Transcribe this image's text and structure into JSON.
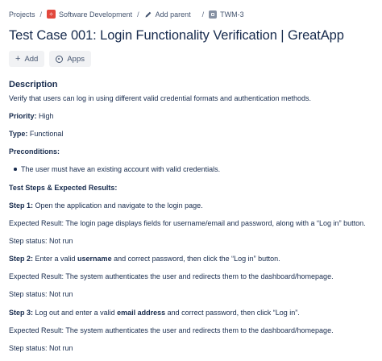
{
  "breadcrumb": {
    "projects": "Projects",
    "project": "Software Development",
    "add_parent": "Add parent",
    "issue_key": "TWM-3"
  },
  "title": "Test Case 001: Login Functionality Verification | GreatApp",
  "actions": {
    "add": "Add",
    "apps": "Apps"
  },
  "description": {
    "heading": "Description",
    "text": "Verify that users can log in using different valid credential formats and authentication methods.",
    "priority_label": "Priority:",
    "priority_value": " High",
    "type_label": "Type:",
    "type_value": " Functional",
    "preconditions_label": "Preconditions:",
    "preconditions": [
      "The user must have an existing account with valid credentials."
    ],
    "steps_label": "Test Steps & Expected Results:",
    "steps": [
      {
        "label": "Step 1:",
        "pre": " Open the application and navigate to the login page.",
        "bold": "",
        "post": "",
        "expected": "Expected Result: The login page displays fields for username/email and password, along with a “Log in” button.",
        "status": "Step status: Not run"
      },
      {
        "label": "Step 2:",
        "pre": " Enter a valid ",
        "bold": "username",
        "post": " and correct password, then click the “Log in” button.",
        "expected": "Expected Result: The system authenticates the user and redirects them to the dashboard/homepage.",
        "status": "Step status: Not run"
      },
      {
        "label": "Step 3:",
        "pre": " Log out and enter a valid ",
        "bold": "email address",
        "post": " and correct password, then click “Log in”.",
        "expected": "Expected Result: The system authenticates the user and redirects them to the dashboard/homepage.",
        "status": "Step status: Not run"
      }
    ]
  }
}
